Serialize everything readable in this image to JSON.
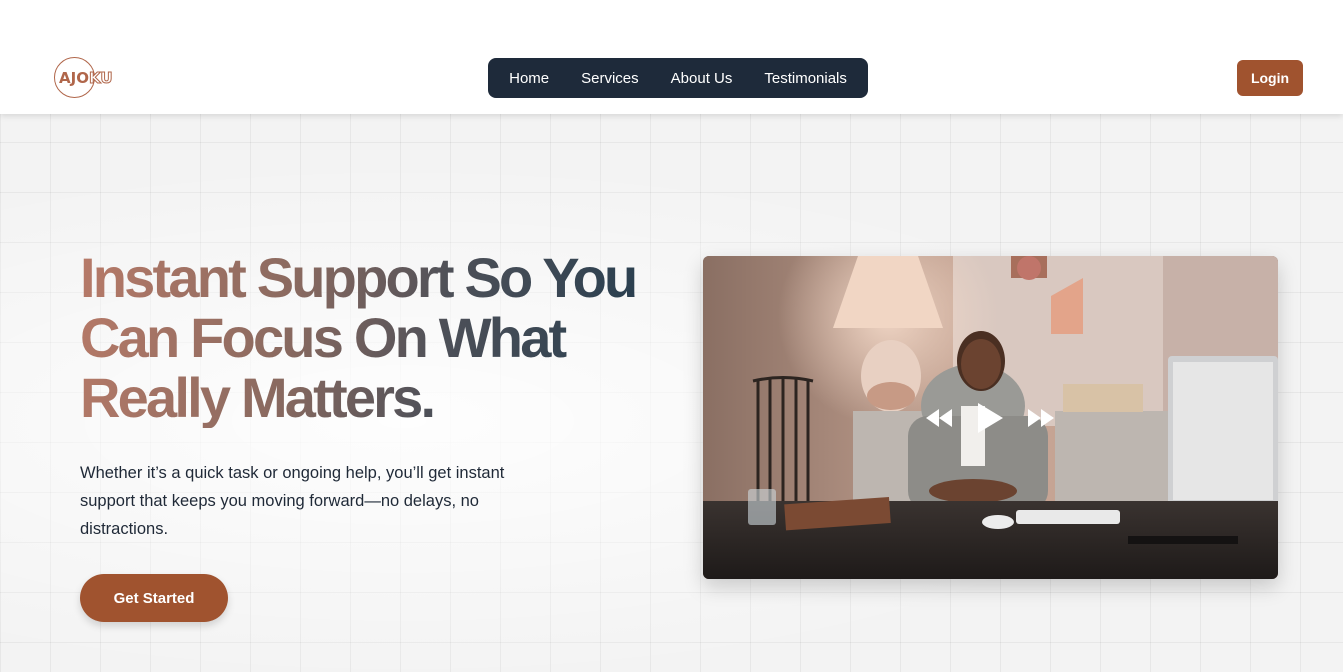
{
  "header": {
    "logo_text_a": "AJO",
    "logo_text_b": "KU",
    "nav": [
      {
        "label": "Home"
      },
      {
        "label": "Services"
      },
      {
        "label": "About Us"
      },
      {
        "label": "Testimonials"
      }
    ],
    "login_label": "Login"
  },
  "hero": {
    "headline": "Instant Support So You Can Focus On What Really Matters.",
    "subtext": "Whether it’s a quick task or ongoing help, you’ll get instant support that keeps you moving forward—no delays, no distractions.",
    "cta_label": "Get Started"
  },
  "video": {
    "icons": [
      "rewind-icon",
      "play-icon",
      "fast-forward-icon"
    ]
  },
  "colors": {
    "accent": "#a0532f",
    "nav_bg": "#1e2a3a",
    "text_dark": "#1f2937"
  }
}
